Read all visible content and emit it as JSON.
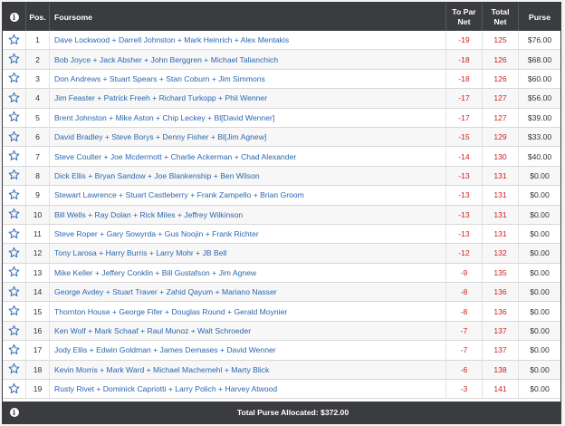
{
  "header": {
    "pos": "Pos.",
    "foursome": "Foursome",
    "to_par_1": "To Par",
    "to_par_2": "Net",
    "total_1": "Total",
    "total_2": "Net",
    "purse": "Purse"
  },
  "rows": [
    {
      "pos": "1",
      "foursome": "Dave Lockwood + Darrell Johnston + Mark Heinrich + Alex Mentakis",
      "to_par": "-19",
      "total": "125",
      "purse": "$76.00"
    },
    {
      "pos": "2",
      "foursome": "Bob Joyce + Jack Absher + John Berggren + Michael Talianchich",
      "to_par": "-18",
      "total": "126",
      "purse": "$68.00"
    },
    {
      "pos": "3",
      "foursome": "Don Andrews + Stuart Spears + Stan Coburn + Jim Simmons",
      "to_par": "-18",
      "total": "126",
      "purse": "$60.00"
    },
    {
      "pos": "4",
      "foursome": "Jim Feaster + Patrick Freeh + Richard Turkopp + Phil Wenner",
      "to_par": "-17",
      "total": "127",
      "purse": "$56.00"
    },
    {
      "pos": "5",
      "foursome": "Brent Johnston + Mike Aston + Chip Leckey + Bl[David Wenner]",
      "to_par": "-17",
      "total": "127",
      "purse": "$39.00"
    },
    {
      "pos": "6",
      "foursome": "David Bradley + Steve Borys + Denny Fisher + Bl[Jim Agnew]",
      "to_par": "-15",
      "total": "129",
      "purse": "$33.00"
    },
    {
      "pos": "7",
      "foursome": "Steve Coulter + Joe Mcdermott + Charlie Ackerman + Chad Alexander",
      "to_par": "-14",
      "total": "130",
      "purse": "$40.00"
    },
    {
      "pos": "8",
      "foursome": "Dick Ellis + Bryan Sandow + Joe Blankenship + Ben Wilson",
      "to_par": "-13",
      "total": "131",
      "purse": "$0.00"
    },
    {
      "pos": "9",
      "foursome": "Stewart Lawrence + Stuart Castleberry + Frank Zampello + Brian Groom",
      "to_par": "-13",
      "total": "131",
      "purse": "$0.00"
    },
    {
      "pos": "10",
      "foursome": "Bill Wells + Ray Dolan + Rick Miles + Jeffrey Wilkinson",
      "to_par": "-13",
      "total": "131",
      "purse": "$0.00"
    },
    {
      "pos": "11",
      "foursome": "Steve Roper + Gary Sowyrda + Gus Noojin + Frank Richter",
      "to_par": "-13",
      "total": "131",
      "purse": "$0.00"
    },
    {
      "pos": "12",
      "foursome": "Tony Larosa + Harry Burris + Larry Mohr + JB Bell",
      "to_par": "-12",
      "total": "132",
      "purse": "$0.00"
    },
    {
      "pos": "13",
      "foursome": "Mike Keller + Jeffery Conklin + Bill Gustafson + Jim Agnew",
      "to_par": "-9",
      "total": "135",
      "purse": "$0.00"
    },
    {
      "pos": "14",
      "foursome": "George Avdey + Stuart Traver + Zahid Qayum + Mariano Nasser",
      "to_par": "-8",
      "total": "136",
      "purse": "$0.00"
    },
    {
      "pos": "15",
      "foursome": "Thornton House + George Fifer + Douglas Round + Gerald Moynier",
      "to_par": "-8",
      "total": "136",
      "purse": "$0.00"
    },
    {
      "pos": "16",
      "foursome": "Ken Wolf + Mark Schaaf + Raul Munoz + Walt Schroeder",
      "to_par": "-7",
      "total": "137",
      "purse": "$0.00"
    },
    {
      "pos": "17",
      "foursome": "Jody Ellis + Edwin Goldman + James Demases + David Wenner",
      "to_par": "-7",
      "total": "137",
      "purse": "$0.00"
    },
    {
      "pos": "18",
      "foursome": "Kevin Morris + Mark Ward + Michael Machemehl + Marty Blick",
      "to_par": "-6",
      "total": "138",
      "purse": "$0.00"
    },
    {
      "pos": "19",
      "foursome": "Rusty Rivet + Dominick Capriotti + Larry Polich + Harvey Atwood",
      "to_par": "-3",
      "total": "141",
      "purse": "$0.00"
    }
  ],
  "footer": {
    "total_purse": "Total Purse Allocated: $372.00"
  },
  "icons": {
    "info": "info-icon",
    "star": "star-outline-icon"
  },
  "colors": {
    "header_bg": "#3a3c40",
    "name_link": "#2a66b0",
    "score_red": "#d21d1d",
    "star_blue": "#2a66b0"
  }
}
